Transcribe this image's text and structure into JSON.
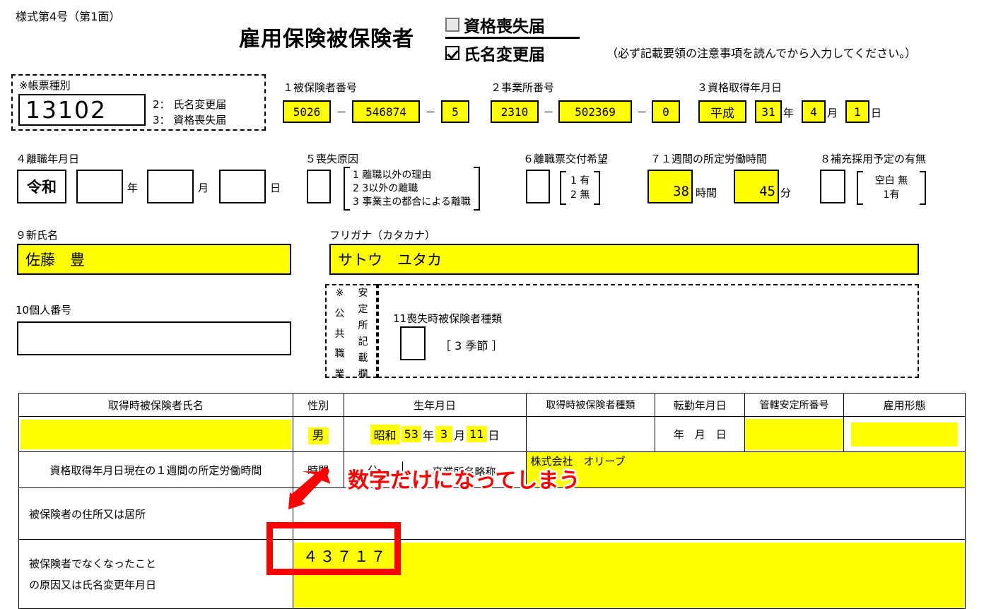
{
  "header": {
    "form_no": "様式第4号（第1面）",
    "title": "雇用保険被保険者",
    "option_loss": "資格喪失届",
    "option_namechange": "氏名変更届",
    "note": "（必ず記載要領の注意事項を読んでから入力してください。）"
  },
  "record_type": {
    "label": "※帳票種別",
    "value": "13102",
    "legend1": "2： 氏名変更届",
    "legend2": "3： 資格喪失届"
  },
  "field1": {
    "label": "１被保険者番号",
    "p1": "5026",
    "p2": "546874",
    "p3": "5",
    "sep": "－"
  },
  "field2": {
    "label": "２事業所番号",
    "p1": "2310",
    "p2": "502369",
    "p3": "0",
    "sep": "－"
  },
  "field3": {
    "label": "３資格取得年月日",
    "era": "平成",
    "year": "31",
    "year_unit": "年",
    "month": "4",
    "month_unit": "月",
    "day": "1",
    "day_unit": "日"
  },
  "field4": {
    "label": "４離職年月日",
    "era": "令和",
    "year": "",
    "year_unit": "年",
    "month": "",
    "month_unit": "月",
    "day": "",
    "day_unit": "日"
  },
  "field5": {
    "label": "５喪失原因",
    "value": "",
    "opt1": "1 離職以外の理由",
    "opt2": "2 3以外の離職",
    "opt3": "3 事業主の都合による離職"
  },
  "field6": {
    "label": "６離職票交付希望",
    "value": "",
    "opt1": "1 有",
    "opt2": "2 無"
  },
  "field7": {
    "label": "７１週間の所定労働時間",
    "hours": "38",
    "hours_unit": "時間",
    "minutes": "45",
    "minutes_unit": "分"
  },
  "field8": {
    "label": "８補充採用予定の有無",
    "value": "",
    "opt1": "空白 無",
    "opt2": "1有"
  },
  "field9": {
    "label": "９新氏名",
    "value": "佐藤　豊",
    "furigana_label": "フリガナ（カタカナ）",
    "furigana_value": "サトウ　ユタカ"
  },
  "field10": {
    "label": "10個人番号",
    "value": ""
  },
  "office_use": {
    "vertical_col1": "※公共職業",
    "vertical_col2": "安定所記載欄",
    "v1_chars": [
      "※",
      "公",
      "共",
      "職",
      "業"
    ],
    "v2_chars": [
      "安",
      "定",
      "所",
      "記",
      "載",
      "欄"
    ],
    "field11_label": "11喪失時被保険者種類",
    "field11_value": "",
    "field11_opt": "［ 3 季節 ］"
  },
  "table": {
    "headers": [
      "取得時被保険者氏名",
      "性別",
      "生年月日",
      "取得時被保険者種類",
      "転勤年月日",
      "管轄安定所番号",
      "雇用形態"
    ],
    "row_values": {
      "name": "",
      "gender": "男",
      "birth_era": "昭和",
      "birth_year": "53",
      "birth_year_unit": "年",
      "birth_month": "3",
      "birth_month_unit": "月",
      "birth_day": "11",
      "birth_day_unit": "日",
      "insured_type": "",
      "transfer_date": "年　月　日",
      "office_no": "",
      "employment_type": ""
    },
    "row2": {
      "label": "資格取得年月日現在の１週間の所定労働時間",
      "hours_unit": "時間",
      "minutes_unit": "分",
      "office_name_label": "事業所名略称",
      "office_name_value": "株式会社　オリーブ"
    },
    "row3": {
      "label": "被保険者の住所又は居所",
      "value": ""
    },
    "row4": {
      "label_line1": "被保険者でなくなったこと",
      "label_line2": "の原因又は氏名変更年月日",
      "value": "４３７１７"
    }
  },
  "annotation": {
    "text": "数字だけになってしまう",
    "color": "#ff0000"
  },
  "colors": {
    "highlight": "#ffff00",
    "annotation": "#ff0000",
    "line": "#000000"
  }
}
